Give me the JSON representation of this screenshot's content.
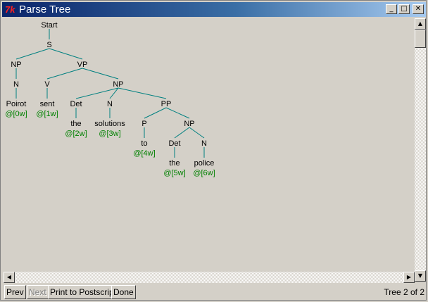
{
  "window": {
    "title": "Parse Tree",
    "icon": "tk-feather-icon"
  },
  "title_buttons": {
    "minimize": "_",
    "maximize": "□",
    "close": "✕"
  },
  "tree": {
    "color_line": "#008080",
    "color_index": "#008000",
    "nodes": [
      {
        "id": "start",
        "label": "Start"
      },
      {
        "id": "s",
        "label": "S"
      },
      {
        "id": "np1",
        "label": "NP"
      },
      {
        "id": "vp",
        "label": "VP"
      },
      {
        "id": "n1",
        "label": "N"
      },
      {
        "id": "v",
        "label": "V"
      },
      {
        "id": "np2",
        "label": "NP"
      },
      {
        "id": "det1",
        "label": "Det"
      },
      {
        "id": "n2",
        "label": "N"
      },
      {
        "id": "pp",
        "label": "PP"
      },
      {
        "id": "p",
        "label": "P"
      },
      {
        "id": "np3",
        "label": "NP"
      },
      {
        "id": "det2",
        "label": "Det"
      },
      {
        "id": "n3",
        "label": "N"
      },
      {
        "id": "w_poirot",
        "label": "Poirot"
      },
      {
        "id": "w_sent",
        "label": "sent"
      },
      {
        "id": "w_the1",
        "label": "the"
      },
      {
        "id": "w_solutions",
        "label": "solutions"
      },
      {
        "id": "w_to",
        "label": "to"
      },
      {
        "id": "w_the2",
        "label": "the"
      },
      {
        "id": "w_police",
        "label": "police"
      },
      {
        "id": "i0",
        "label": "@[0w]",
        "kind": "index"
      },
      {
        "id": "i1",
        "label": "@[1w]",
        "kind": "index"
      },
      {
        "id": "i2",
        "label": "@[2w]",
        "kind": "index"
      },
      {
        "id": "i3",
        "label": "@[3w]",
        "kind": "index"
      },
      {
        "id": "i4",
        "label": "@[4w]",
        "kind": "index"
      },
      {
        "id": "i5",
        "label": "@[5w]",
        "kind": "index"
      },
      {
        "id": "i6",
        "label": "@[6w]",
        "kind": "index"
      }
    ],
    "edges": [
      [
        "start",
        "s"
      ],
      [
        "s",
        "np1"
      ],
      [
        "s",
        "vp"
      ],
      [
        "np1",
        "n1"
      ],
      [
        "n1",
        "w_poirot"
      ],
      [
        "vp",
        "v"
      ],
      [
        "vp",
        "np2"
      ],
      [
        "v",
        "w_sent"
      ],
      [
        "np2",
        "det1"
      ],
      [
        "np2",
        "n2"
      ],
      [
        "np2",
        "pp"
      ],
      [
        "det1",
        "w_the1"
      ],
      [
        "n2",
        "w_solutions"
      ],
      [
        "pp",
        "p"
      ],
      [
        "pp",
        "np3"
      ],
      [
        "p",
        "w_to"
      ],
      [
        "np3",
        "det2"
      ],
      [
        "np3",
        "n3"
      ],
      [
        "det2",
        "w_the2"
      ],
      [
        "n3",
        "w_police"
      ]
    ]
  },
  "buttons": {
    "prev": "Prev",
    "next": "Next",
    "print": "Print to Postscript",
    "done": "Done"
  },
  "status": "Tree 2 of 2"
}
